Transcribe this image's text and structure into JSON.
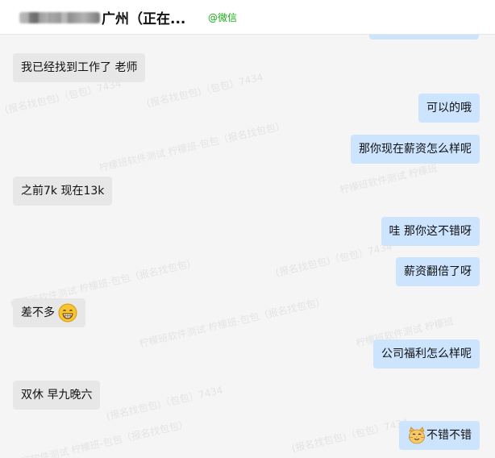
{
  "header": {
    "contact_name": "广州（正在...",
    "source_tag": "@微信"
  },
  "messages": [
    {
      "side": "in",
      "text": "我已经找到工作了 老师"
    },
    {
      "side": "out",
      "text": "可以的哦"
    },
    {
      "side": "out",
      "text": "那你现在薪资怎么样呢"
    },
    {
      "side": "in",
      "text": "之前7k 现在13k"
    },
    {
      "side": "out",
      "text": "哇 那你这不错呀"
    },
    {
      "side": "out",
      "text": "薪资翻倍了呀"
    },
    {
      "side": "in",
      "text": "差不多",
      "emoji": "grinning-face-icon"
    },
    {
      "side": "out",
      "text": "公司福利怎么样呢"
    },
    {
      "side": "in",
      "text": "双休 早九晚六"
    },
    {
      "side": "out",
      "text": "不错不错",
      "emoji": "cat-face-icon"
    }
  ],
  "watermark": {
    "text_a": "(报名找包包)（包包）7434",
    "text_b": "柠檬班软件测试 柠檬班-包包（报名找包包）",
    "text_c": "柠檬班软件测试 柠檬班"
  },
  "colors": {
    "outgoing_bubble": "#cde4ff",
    "incoming_bubble": "#e7e7e7",
    "source_tag": "#1aad19"
  }
}
